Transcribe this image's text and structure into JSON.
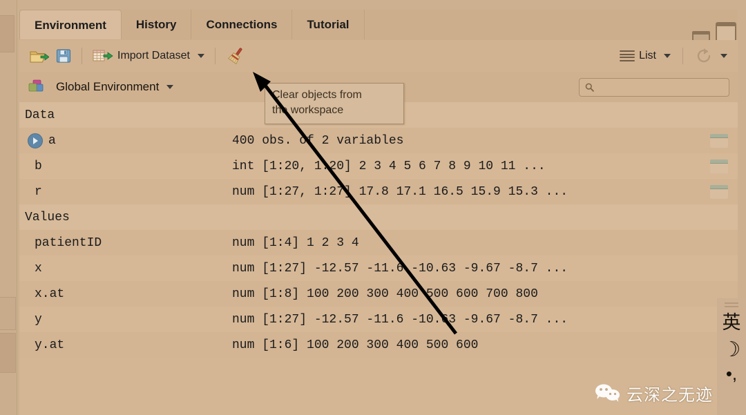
{
  "window": {
    "minimize_icon": "window-minimize-icon",
    "maximize_icon": "window-maximize-icon"
  },
  "tabs": [
    {
      "label": "Environment",
      "active": true
    },
    {
      "label": "History",
      "active": false
    },
    {
      "label": "Connections",
      "active": false
    },
    {
      "label": "Tutorial",
      "active": false
    }
  ],
  "toolbar": {
    "open_icon": "open-folder-icon",
    "save_icon": "save-disk-icon",
    "import_icon": "import-dataset-icon",
    "import_label": "Import Dataset",
    "broom_icon": "broom-clear-icon",
    "list_icon": "list-view-icon",
    "list_label": "List",
    "refresh_icon": "refresh-icon"
  },
  "env_selector": {
    "icon": "global-environment-icon",
    "label": "Global Environment",
    "caret_icon": "chevron-down-icon"
  },
  "search": {
    "icon": "search-icon",
    "value": "",
    "placeholder": ""
  },
  "tooltip": {
    "line1": "Clear objects from",
    "line2": "the workspace"
  },
  "table": {
    "groups": [
      {
        "label": "Data",
        "rows": [
          {
            "name": "a",
            "value": "400 obs. of 2 variables",
            "expandable": true,
            "grid": true
          },
          {
            "name": "b",
            "value": "int [1:20, 1:20] 2 3 4 5 6 7 8 9 10 11 ...",
            "expandable": false,
            "grid": true
          },
          {
            "name": "r",
            "value": "num [1:27, 1:27] 17.8 17.1 16.5 15.9 15.3 ...",
            "expandable": false,
            "grid": true
          }
        ]
      },
      {
        "label": "Values",
        "rows": [
          {
            "name": "patientID",
            "value": "num [1:4] 1 2 3 4",
            "expandable": false,
            "grid": false
          },
          {
            "name": "x",
            "value": "num [1:27] -12.57 -11.6 -10.63 -9.67 -8.7 ...",
            "expandable": false,
            "grid": false
          },
          {
            "name": "x.at",
            "value": "num [1:8] 100 200 300 400 500 600 700 800",
            "expandable": false,
            "grid": false
          },
          {
            "name": "y",
            "value": "num [1:27] -12.57 -11.6 -10.63 -9.67 -8.7 ...",
            "expandable": false,
            "grid": false
          },
          {
            "name": "y.at",
            "value": "num [1:6] 100 200 300 400 500 600",
            "expandable": false,
            "grid": false
          }
        ]
      }
    ]
  },
  "ime": {
    "mode": "英",
    "moon_icon": "☽",
    "punct_icon": "•,"
  },
  "watermark": {
    "icon": "wechat-icon",
    "text": "云深之无迹"
  },
  "colors": {
    "background": "#cdb090",
    "pane": "#d3b492",
    "tab_active": "#d8bc9d",
    "row_alt": "#d3b493",
    "accent_blue": "#5f87a8",
    "text": "#1a1a1a"
  }
}
